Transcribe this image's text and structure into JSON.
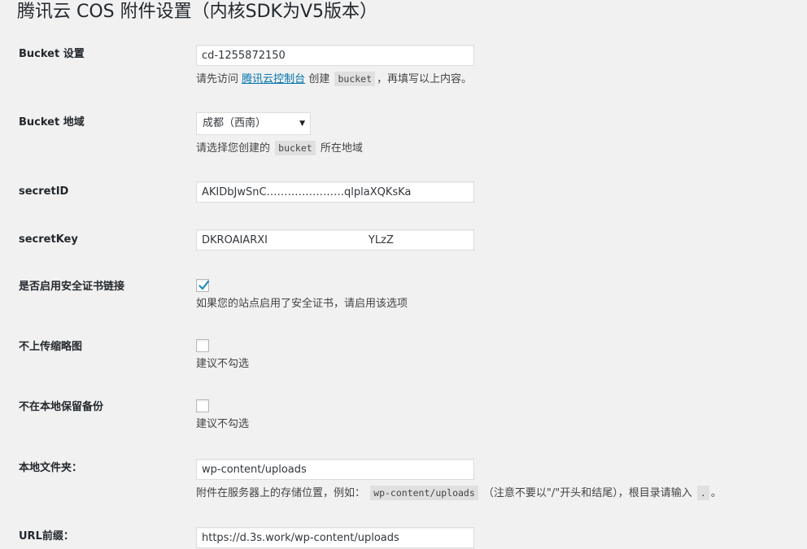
{
  "page": {
    "title": "腾讯云 COS 附件设置（内核SDK为V5版本）"
  },
  "bucket": {
    "label": "Bucket 设置",
    "value": "cd-1255872150",
    "desc_prefix": "请先访问",
    "desc_link": "腾讯云控制台",
    "desc_middle": "创建",
    "desc_code": "bucket",
    "desc_suffix": "，再填写以上内容。"
  },
  "region": {
    "label": "Bucket 地域",
    "selected": "成都（西南）",
    "desc_prefix": "请选择您创建的",
    "desc_code": "bucket",
    "desc_suffix": "所在地域"
  },
  "secret_id": {
    "label": "secretID",
    "value": "AKIDbJwSnC‥‥‥‥‥‥‥‥‥‥‥qlplaXQKsKa"
  },
  "secret_key": {
    "label": "secretKey",
    "value": "DKROAIARXI                              YLzZ"
  },
  "https": {
    "label": "是否启用安全证书链接",
    "checked": true,
    "desc": "如果您的站点启用了安全证书，请启用该选项"
  },
  "no_thumb": {
    "label": "不上传缩略图",
    "checked": false,
    "desc": "建议不勾选"
  },
  "no_local": {
    "label": "不在本地保留备份",
    "checked": false,
    "desc": "建议不勾选"
  },
  "local_folder": {
    "label": "本地文件夹：",
    "value": "wp-content/uploads",
    "desc_prefix": "附件在服务器上的存储位置，例如：",
    "desc_code": "wp-content/uploads",
    "desc_middle": "（注意不要以\"/\"开头和结尾），根目录请输入",
    "desc_code2": ".",
    "desc_suffix": "。"
  },
  "url_prefix": {
    "label": "URL前缀：",
    "value": "https://d.3s.work/wp-content/uploads"
  },
  "colors": {
    "accent": "#0073aa",
    "check": "#1e8cbe",
    "background": "#f1f1f1"
  }
}
